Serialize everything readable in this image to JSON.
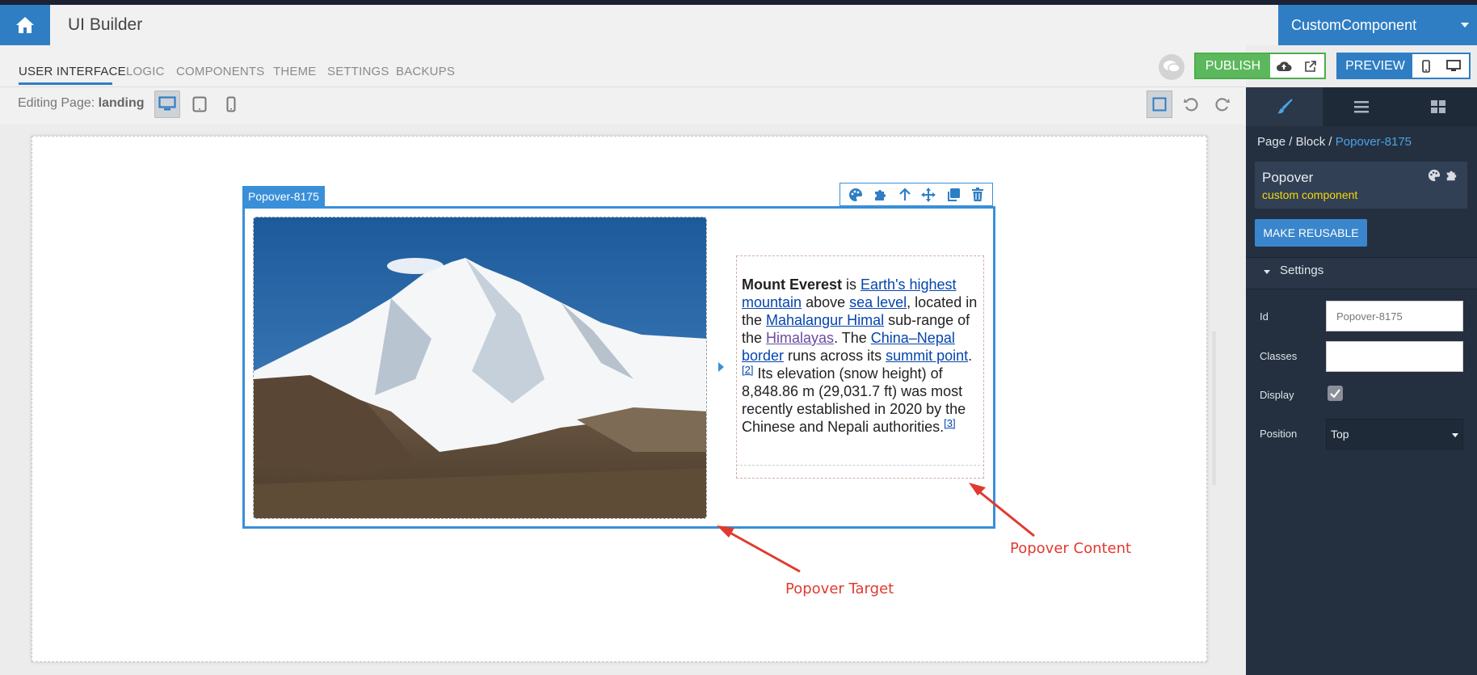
{
  "app": {
    "title": "UI Builder",
    "component_select": "CustomComponent"
  },
  "nav": {
    "tabs": [
      "USER INTERFACE",
      "LOGIC",
      "COMPONENTS",
      "THEME",
      "SETTINGS",
      "BACKUPS"
    ],
    "active_tab": "USER INTERFACE",
    "publish_label": "PUBLISH",
    "preview_label": "PREVIEW"
  },
  "toolbar": {
    "editing_prefix": "Editing Page:",
    "page_name": "landing"
  },
  "canvas": {
    "popover_id_label": "Popover-8175",
    "content": {
      "bold_title": "Mount Everest",
      "t1": " is ",
      "link_earth": "Earth's highest mountain",
      "t2": " above ",
      "link_sea": "sea level",
      "t3": ", located in the ",
      "link_mahalangur": "Mahalangur Himal",
      "t4": " sub-range of the ",
      "link_himalayas": "Himalayas",
      "t5": ". The ",
      "link_border": "China–Nepal border",
      "t6": " runs across its ",
      "link_summit": "summit point",
      "t7": ".",
      "ref2": "[2]",
      "t8": " Its elevation (snow height) of 8,848.86 m (29,031.7 ft) was most recently established in 2020 by the Chinese and Nepali authorities.",
      "ref3": "[3]"
    },
    "annotations": {
      "content_label": "Popover Content",
      "target_label": "Popover Target"
    }
  },
  "sidebar": {
    "breadcrumb": {
      "page": "Page",
      "sep1": " / ",
      "block": "Block",
      "sep2": " / ",
      "current": "Popover-8175"
    },
    "component": {
      "name": "Popover",
      "type": "custom component"
    },
    "make_reusable_label": "MAKE REUSABLE",
    "settings_header": "Settings",
    "fields": {
      "id_label": "Id",
      "id_value": "Popover-8175",
      "classes_label": "Classes",
      "classes_value": "",
      "display_label": "Display",
      "display_checked": true,
      "position_label": "Position",
      "position_value": "Top"
    }
  },
  "colors": {
    "accent": "#2f7ec4",
    "publish_green": "#5cb85c",
    "annotation_red": "#e03a2f",
    "sidebar_bg": "#243040",
    "component_type": "#f5d90a"
  },
  "icons": [
    "home-icon",
    "chat-icon",
    "cloud-upload-icon",
    "external-link-icon",
    "mobile-icon",
    "desktop-icon",
    "tablet-icon",
    "select-mode-icon",
    "undo-icon",
    "redo-icon",
    "paint-brush-icon",
    "list-icon",
    "grid-icon",
    "palette-icon",
    "puzzle-icon",
    "arrow-up-icon",
    "move-icon",
    "copy-icon",
    "trash-icon",
    "check-icon"
  ]
}
